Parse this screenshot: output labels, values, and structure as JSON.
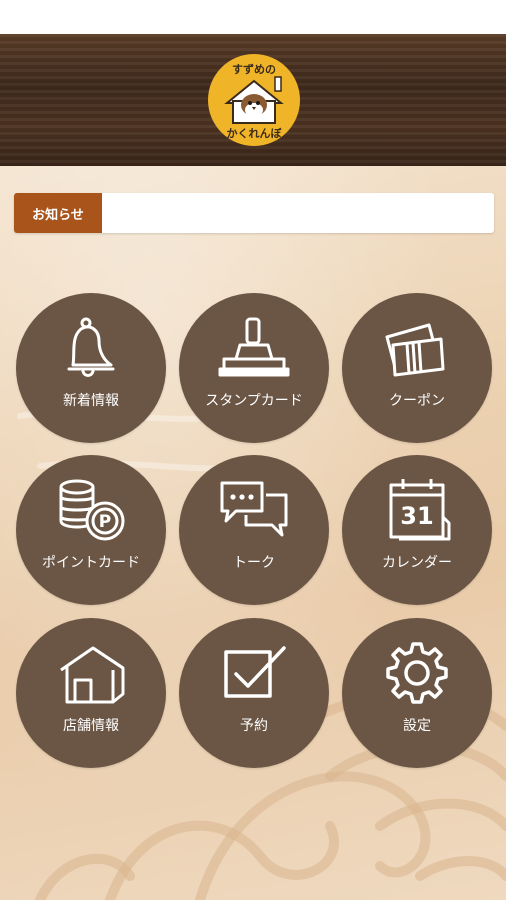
{
  "header": {
    "logo_line1": "すずめの",
    "logo_line2": "かくれんぼ",
    "logo_color": "#f0b428"
  },
  "notice": {
    "label": "お知らせ",
    "text": ""
  },
  "menu": [
    {
      "label": "新着情報",
      "icon": "bell-icon"
    },
    {
      "label": "スタンプカード",
      "icon": "stamp-icon"
    },
    {
      "label": "クーポン",
      "icon": "coupon-icon"
    },
    {
      "label": "ポイントカード",
      "icon": "point-coins-icon"
    },
    {
      "label": "トーク",
      "icon": "chat-bubbles-icon"
    },
    {
      "label": "カレンダー",
      "icon": "calendar-icon"
    },
    {
      "label": "店舗情報",
      "icon": "house-icon"
    },
    {
      "label": "予約",
      "icon": "checkbox-icon"
    },
    {
      "label": "設定",
      "icon": "gear-icon"
    }
  ],
  "calendar_day": "31",
  "point_letter": "P",
  "colors": {
    "accent": "#a8541a",
    "button": "#6b5645",
    "header_wood": "#4a3120"
  }
}
